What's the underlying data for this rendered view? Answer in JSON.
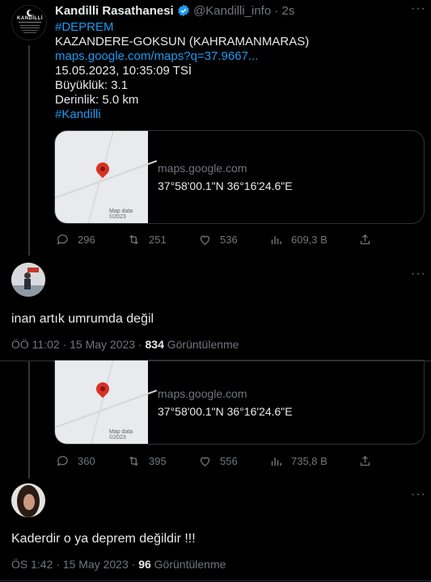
{
  "tweet1": {
    "name": "Kandilli Rasathanesi",
    "handle": "@Kandilli_info",
    "sep": "·",
    "time": "2s",
    "hashtag1": "#DEPREM",
    "line1": "KAZANDERE-GOKSUN (KAHRAMANMARAS)",
    "link": "maps.google.com/maps?q=37.9667...",
    "line_date": "15.05.2023, 10:35:09 TSİ",
    "line_mag": "Büyüklük: 3.1",
    "line_depth": "Derinlik: 5.0 km",
    "hashtag2": "#Kandilli",
    "logo_text": "KANDİLLİ",
    "card": {
      "domain": "maps.google.com",
      "coords": "37°58'00.1\"N 36°16'24.6\"E",
      "credit": "Map data ©2023"
    },
    "stats": {
      "replies": "296",
      "retweets": "251",
      "likes": "536",
      "views": "609,3 B"
    }
  },
  "reply1": {
    "text": "inan artık umrumda değil",
    "time": "ÖÖ 11:02 · 15 May 2023 ·",
    "views_count": "834",
    "views_label": "Görüntülenme",
    "card": {
      "domain": "maps.google.com",
      "coords": "37°58'00.1\"N 36°16'24.6\"E",
      "credit": "Map data ©2023"
    },
    "stats": {
      "replies": "360",
      "retweets": "395",
      "likes": "556",
      "views": "735,8 B"
    }
  },
  "reply2": {
    "text": "Kaderdir o ya deprem değildir !!!",
    "time": "ÖS 1:42 · 15 May 2023 ·",
    "views_count": "96",
    "views_label": "Görüntülenme"
  },
  "colors": {
    "accent": "#1d9bf0",
    "muted": "#71767b",
    "pin": "#d93025"
  }
}
